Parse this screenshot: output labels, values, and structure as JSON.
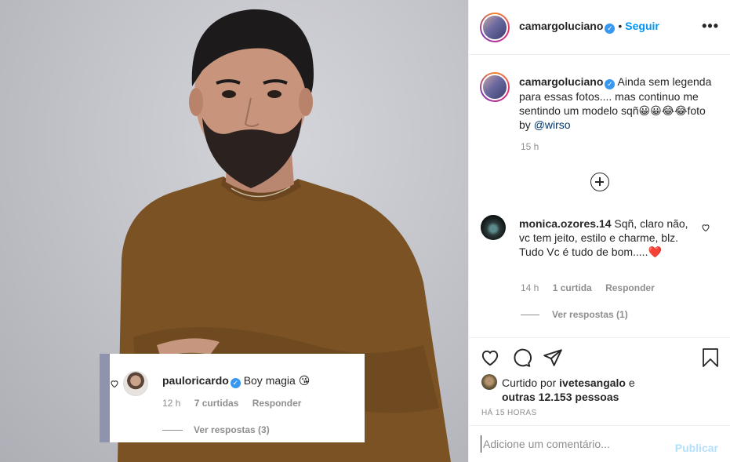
{
  "post": {
    "username": "camargoluciano",
    "follow_label": "Seguir",
    "more_menu": "•••",
    "caption_text": "Ainda sem legenda para essas fotos.... mas continuo me sentindo um modelo sqñ😀😀😂😂foto by ",
    "caption_mention": "@wirso",
    "caption_time": "15 h"
  },
  "comments": [
    {
      "username": "monica.ozores.14",
      "text": "Sqñ, claro não, vc tem jeito, estilo e charme, blz. Tudo Vc é tudo de bom.....❤️",
      "time": "14 h",
      "likes": "1 curtida",
      "reply": "Responder",
      "view_replies": "Ver respostas (1)"
    }
  ],
  "embedded_comment": {
    "username": "pauloricardo",
    "text": "Boy magia 😘",
    "time": "12 h",
    "likes": "7 curtidas",
    "reply": "Responder",
    "view_replies": "Ver respostas (3)"
  },
  "likes": {
    "prefix": "Curtido por",
    "user": "ivetesangalo",
    "joiner": "e",
    "others": "outras 12.153 pessoas"
  },
  "posted_ago": "HÁ 15 HORAS",
  "add_comment": {
    "placeholder": "Adicione um comentário...",
    "post_label": "Publicar"
  },
  "icons": {
    "like": "heart-icon",
    "comment": "comment-icon",
    "share": "share-icon",
    "save": "bookmark-icon",
    "add": "plus-circle-icon",
    "verified": "verified-badge-icon"
  },
  "colors": {
    "link": "#0095f6",
    "muted": "#8e8e8e",
    "publish_disabled": "#b2dffc"
  }
}
